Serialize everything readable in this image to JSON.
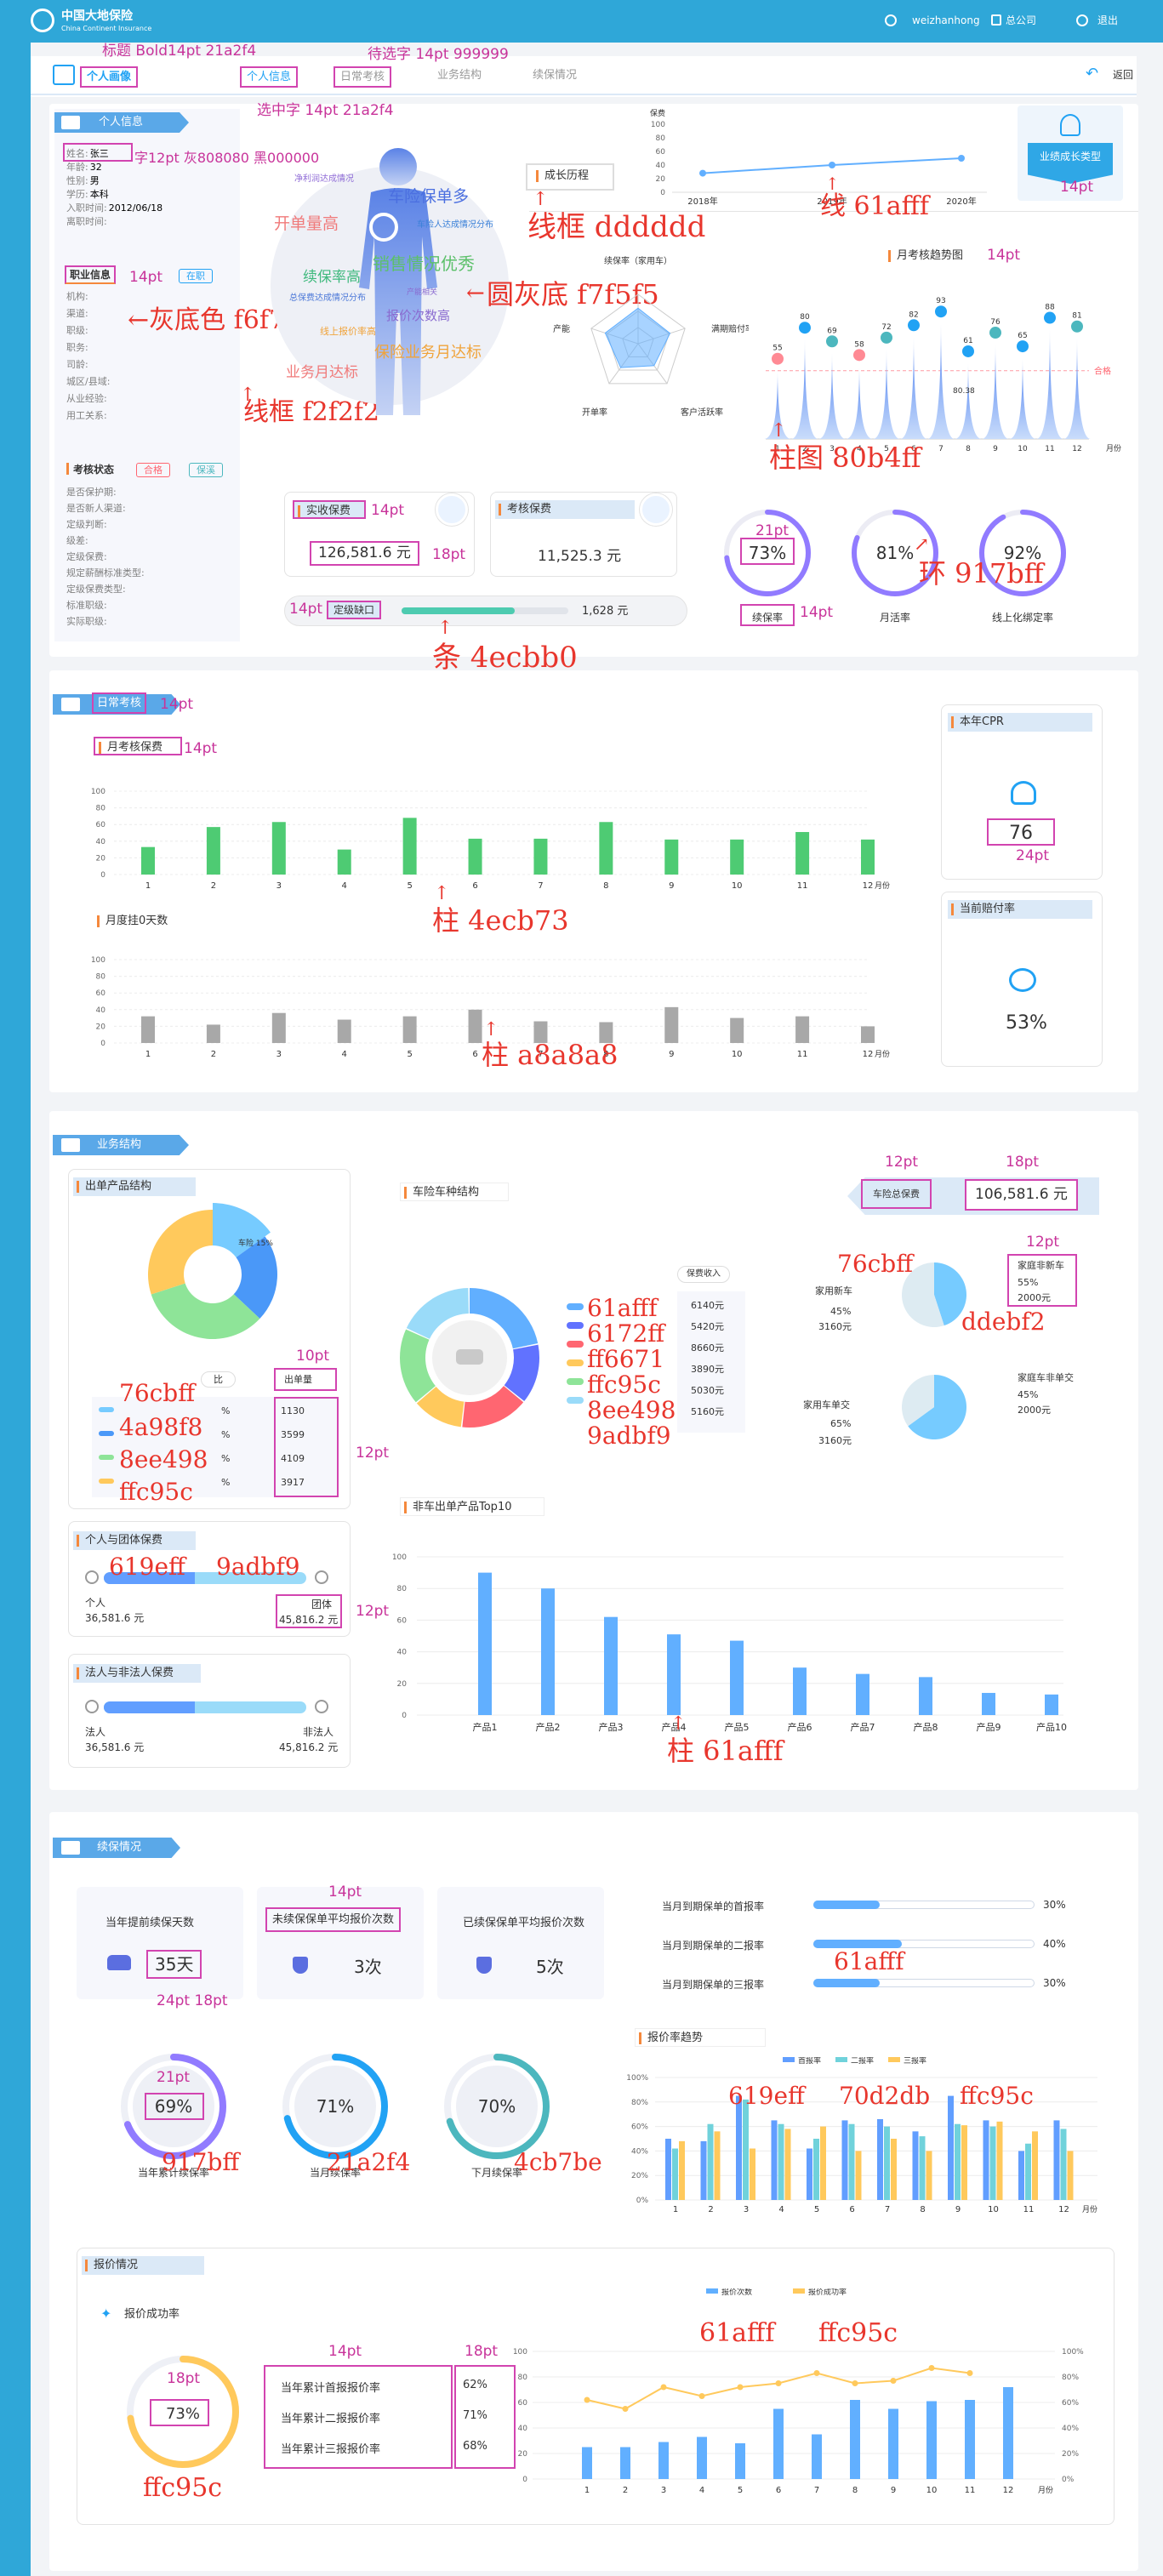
{
  "header": {
    "brand_cn": "中国大地保险",
    "brand_en": "China Continent Insurance",
    "username": "weizhanhong",
    "company": "总公司",
    "logout": "退出",
    "back": "返回",
    "tabs": [
      "个人画像",
      "个人信息",
      "日常考核",
      "业务结构",
      "续保情况"
    ]
  },
  "annotations": {
    "title": "标题 Bold14pt 21a2f4",
    "pending": "待选字 14pt 999999",
    "selected": "选中字 14pt 21a2f4",
    "label_colors": "字12pt 灰808080 黑000000",
    "line_frame": "线框 dddddd",
    "line": "线 61afff",
    "circle_bg": "圆灰底 f7f5f5",
    "gray_bg": "←灰底色 f6f7fc",
    "frame2": "线框 f2f2f2",
    "bar": "柱图 80b4ff",
    "ring": "环 917bff",
    "strip": "条 4ecbb0",
    "bar_green": "柱 4ecb73",
    "bar_gray": "柱 a8a8a8",
    "bar_blue": "柱 61afff",
    "bar_blue2": "柱 61afff",
    "c619eff": "619eff",
    "c9adbf9": "9adbf9",
    "c76cbff": "76cbff",
    "cddebf2": "ddebf2",
    "c76cbff2": "76cbff",
    "c4a98f8": "4a98f8",
    "c8ee498": "8ee498",
    "cffc95c": "ffc95c",
    "c61afff": "61afff",
    "c6172ff": "6172ff",
    "cff6671": "ff6671",
    "cffc95c2": "ffc95c",
    "c8ee4982": "8ee498",
    "c9adbf92": "9adbf9",
    "c917bff": "917bff",
    "c21a2f4": "21a2f4",
    "c4cb7be": "4cb7be",
    "c61afff2": "61afff",
    "c619eff2": "619eff",
    "c70d2db": "70d2db",
    "cffc95c3": "ffc95c",
    "cffc95c4": "ffc95c",
    "c61afff3": "61afff",
    "cffc95c5": "ffc95c",
    "pt14": "14pt",
    "pt18": "18pt",
    "pt21": "21pt",
    "pt24": "24pt",
    "pt12": "12pt",
    "pt10": "10pt"
  },
  "profile": {
    "section": "个人信息",
    "fields": [
      {
        "label": "姓名:",
        "value": "张三"
      },
      {
        "label": "年龄:",
        "value": "32"
      },
      {
        "label": "性别:",
        "value": "男"
      },
      {
        "label": "学历:",
        "value": "本科"
      },
      {
        "label": "入职时间:",
        "value": "2012/06/18"
      },
      {
        "label": "离职时间:",
        "value": ""
      }
    ],
    "job_title": "职业信息",
    "job_status": "在职",
    "job_fields": [
      "机构:",
      "渠道:",
      "职级:",
      "职务:",
      "司龄:",
      "城区/县域:",
      "从业经验:",
      "用工关系:"
    ],
    "assess_title": "考核状态",
    "assess_tags": [
      "合格",
      "保溪"
    ],
    "assess_fields": [
      "是否保护期:",
      "是否新人渠道:",
      "定级判断:",
      "级差:",
      "定级保费:",
      "规定薪酬标准类型:",
      "定级保费类型:",
      "标准职级:",
      "实际职级:"
    ]
  },
  "portrait": {
    "tags": [
      "净利润达成情况",
      "车险保单多",
      "车险人达成情况分布",
      "开单量高",
      "销售情况优秀",
      "续保率高",
      "总保费达成情况分布",
      "产能相关",
      "报价次数高",
      "线上报价率高",
      "保险业务月达标",
      "业务月达标"
    ],
    "history_title": "成长历程",
    "growth_badge": "业绩成长类型",
    "radar_labels": [
      "续保率（家用车）",
      "满期赔付率",
      "客户活跃率",
      "开单率",
      "产能"
    ],
    "history_chart": {
      "ylabel": "保费",
      "yticks": [
        "100",
        "80",
        "60",
        "40",
        "20",
        "0"
      ],
      "x": [
        "2018年",
        "2019年",
        "2020年"
      ],
      "y": [
        28,
        40,
        50
      ]
    }
  },
  "monthly_trend": {
    "title": "月考核趋势图",
    "ref_label": "合格",
    "mid_label": "80.38",
    "x": [
      "1",
      "2",
      "3",
      "4",
      "5",
      "6",
      "7",
      "8",
      "9",
      "10",
      "11",
      "12"
    ],
    "values": [
      55,
      80,
      69,
      58,
      72,
      82,
      93,
      61,
      76,
      65,
      88,
      81
    ],
    "xlabel": "月份"
  },
  "kpi": {
    "actual_label": "实收保费",
    "actual_value": "126,581.6 元",
    "assess_label": "考核保费",
    "assess_value": "11,525.3 元",
    "gap_label": "定级缺口",
    "gap_value": "1,628 元",
    "gap_progress": 0.68,
    "rings": [
      {
        "label": "续保率",
        "value": "73%",
        "ratio": 0.73,
        "color": "#917bff"
      },
      {
        "label": "月活率",
        "value": "81%",
        "ratio": 0.81,
        "color": "#917bff"
      },
      {
        "label": "线上化绑定率",
        "value": "92%",
        "ratio": 0.92,
        "color": "#917bff"
      }
    ]
  },
  "daily": {
    "section": "日常考核",
    "chart1_title": "月考核保费",
    "chart2_title": "月度挂0天数",
    "xlabel": "月份",
    "yticks": [
      "100",
      "80",
      "60",
      "40",
      "20",
      "0"
    ],
    "x": [
      "1",
      "2",
      "3",
      "4",
      "5",
      "6",
      "7",
      "8",
      "9",
      "10",
      "11",
      "12"
    ],
    "green": [
      33,
      57,
      63,
      30,
      68,
      43,
      43,
      63,
      42,
      42,
      51,
      42
    ],
    "gray": [
      32,
      22,
      36,
      28,
      32,
      40,
      26,
      25,
      43,
      30,
      32,
      20
    ],
    "cpr_title": "本年CPR",
    "cpr_value": "76",
    "loss_title": "当前赔付率",
    "loss_value": "53%"
  },
  "business": {
    "section": "业务结构",
    "product_title": "出单产品结构",
    "pie_label": "车险 15%",
    "col_header_left": "比",
    "col_header_right": "出单量",
    "product_values": [
      "1130",
      "3599",
      "4109",
      "3917"
    ],
    "product_pcts": [
      "%",
      "%",
      "%",
      "%"
    ],
    "pie_values": [
      15,
      22,
      33,
      30
    ],
    "vehicle_title": "车险车种结构",
    "donut_values": [
      22,
      14,
      16,
      12,
      18,
      18
    ],
    "income_title": "保费收入",
    "income_values": [
      "6140元",
      "5420元",
      "8660元",
      "3890元",
      "5030元",
      "5160元"
    ],
    "total_label": "车险总保费",
    "total_value": "106,581.6 元",
    "new_car_title": "家用新车",
    "new_car_pct": "45%",
    "new_car_amt": "3160元",
    "new_car_right_title": "家庭非新车",
    "new_car_right_pct": "55%",
    "new_car_right_amt": "2000元",
    "trade_title": "家用车单交",
    "trade_pct": "65%",
    "trade_amt": "3160元",
    "trade_right_title": "家庭车非单交",
    "trade_right_pct": "45%",
    "trade_right_amt": "2000元",
    "pie_small1": [
      45,
      55
    ],
    "pie_small2": [
      65,
      35
    ],
    "person_title": "个人与团体保费",
    "person_left": "个人",
    "person_left_value": "36,581.6 元",
    "person_right": "团体",
    "person_right_value": "45,816.2 元",
    "person_ratio": 0.45,
    "legal_title": "法人与非法人保费",
    "legal_left": "法人",
    "legal_left_value": "36,581.6 元",
    "legal_right": "非法人",
    "legal_right_value": "45,816.2 元",
    "legal_ratio": 0.45,
    "top10_title": "非车出单产品Top10",
    "top10_x": [
      "产品1",
      "产品2",
      "产品3",
      "产品4",
      "产品5",
      "产品6",
      "产品7",
      "产品8",
      "产品9",
      "产品10"
    ],
    "top10_values": [
      90,
      80,
      62,
      51,
      47,
      30,
      26,
      24,
      14,
      13
    ],
    "top10_yticks": [
      "100",
      "80",
      "60",
      "40",
      "20",
      "0"
    ]
  },
  "renewal": {
    "section": "续保情况",
    "cards": [
      {
        "label": "当年提前续保天数",
        "value": "35天"
      },
      {
        "label": "未续保保单平均报价次数",
        "value": "3次"
      },
      {
        "label": "已续保保单平均报价次数",
        "value": "5次"
      }
    ],
    "quote_rates": [
      {
        "label": "当月到期保单的首报率",
        "value": "30%",
        "ratio": 0.3
      },
      {
        "label": "当月到期保单的二报率",
        "value": "40%",
        "ratio": 0.4
      },
      {
        "label": "当月到期保单的三报率",
        "value": "30%",
        "ratio": 0.3
      }
    ],
    "rings": [
      {
        "label": "当年累计续保率",
        "value": "69%",
        "ratio": 0.69,
        "color": "#917bff"
      },
      {
        "label": "当月续保率",
        "value": "71%",
        "ratio": 0.71,
        "color": "#21a2f4"
      },
      {
        "label": "下月续保率",
        "value": "70%",
        "ratio": 0.7,
        "color": "#4cb7be"
      }
    ],
    "trend_title": "报价率趋势",
    "trend_legend": [
      "首报率",
      "二报率",
      "三报率"
    ],
    "trend_yticks": [
      "100%",
      "80%",
      "60%",
      "40%",
      "20%",
      "0%"
    ],
    "trend_x": [
      "1",
      "2",
      "3",
      "4",
      "5",
      "6",
      "7",
      "8",
      "9",
      "10",
      "11",
      "12"
    ],
    "trend_s1": [
      50,
      48,
      85,
      65,
      42,
      65,
      66,
      56,
      85,
      65,
      40,
      65
    ],
    "trend_s2": [
      42,
      62,
      82,
      62,
      50,
      62,
      60,
      52,
      62,
      60,
      46,
      58
    ],
    "trend_s3": [
      48,
      56,
      42,
      58,
      60,
      40,
      50,
      40,
      61,
      64,
      56,
      40
    ]
  },
  "quote": {
    "title": "报价情况",
    "sub": "报价成功率",
    "ring_value": "73%",
    "ring_ratio": 0.73,
    "rows": [
      {
        "label": "当年累计首报报价率",
        "value": "62%"
      },
      {
        "label": "当年累计二报报价率",
        "value": "71%"
      },
      {
        "label": "当年累计三报报价率",
        "value": "68%"
      }
    ],
    "legend": [
      "报价次数",
      "报价成功率"
    ],
    "yticks_left": [
      "100",
      "80",
      "60",
      "40",
      "20",
      "0"
    ],
    "yticks_right": [
      "100%",
      "80%",
      "60%",
      "40%",
      "20%",
      "0%"
    ],
    "x": [
      "1",
      "2",
      "3",
      "4",
      "5",
      "6",
      "7",
      "8",
      "9",
      "10",
      "11",
      "12"
    ],
    "bars": [
      25,
      25,
      29,
      33,
      28,
      55,
      35,
      62,
      55,
      61,
      62,
      72
    ],
    "line": [
      62,
      55,
      72,
      65,
      72,
      75,
      83,
      75,
      77,
      87,
      83,
      0
    ],
    "xlabel": "月份"
  }
}
